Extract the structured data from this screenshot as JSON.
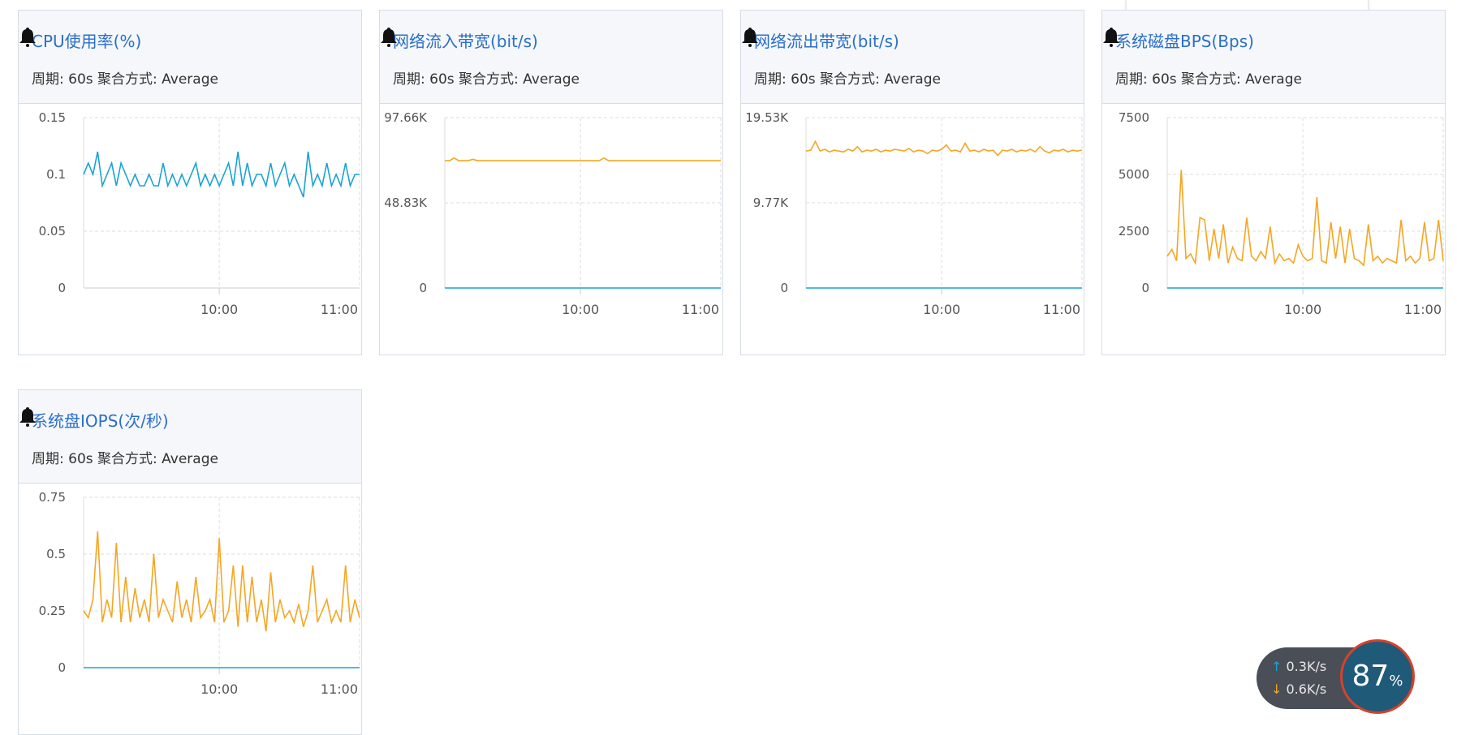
{
  "cards": [
    {
      "title": "CPU使用率(%)",
      "meta": "周期: 60s   聚合方式: Average"
    },
    {
      "title": "网络流入带宽(bit/s)",
      "meta": "周期: 60s   聚合方式: Average"
    },
    {
      "title": "网络流出带宽(bit/s)",
      "meta": "周期: 60s   聚合方式: Average"
    },
    {
      "title": "系统磁盘BPS(Bps)",
      "meta": "周期: 60s   聚合方式: Average"
    },
    {
      "title": "系统盘IOPS(次/秒)",
      "meta": "周期: 60s   聚合方式: Average"
    }
  ],
  "widget": {
    "up": "0.3K/s",
    "down": "0.6K/s",
    "percent": "87",
    "percent_sign": "%"
  },
  "colors": {
    "title": "#2a6fc9",
    "orange": "#f5a623",
    "blue": "#1aa3d3"
  },
  "chart_data": [
    {
      "type": "line",
      "ylim": [
        0,
        0.15
      ],
      "yticks": [
        "0",
        "0.05",
        "0.1",
        "0.15"
      ],
      "xticks": [
        {
          "x": 29,
          "label": "10:00"
        },
        {
          "x": 59,
          "label": "11:00"
        }
      ],
      "series": [
        {
          "color": "#1aa3d3",
          "values": [
            0.1,
            0.11,
            0.1,
            0.12,
            0.09,
            0.1,
            0.11,
            0.09,
            0.11,
            0.1,
            0.09,
            0.1,
            0.09,
            0.09,
            0.1,
            0.09,
            0.09,
            0.11,
            0.09,
            0.1,
            0.09,
            0.1,
            0.09,
            0.1,
            0.11,
            0.09,
            0.1,
            0.09,
            0.1,
            0.09,
            0.1,
            0.11,
            0.09,
            0.12,
            0.09,
            0.11,
            0.09,
            0.1,
            0.1,
            0.09,
            0.11,
            0.09,
            0.1,
            0.11,
            0.09,
            0.1,
            0.09,
            0.08,
            0.12,
            0.09,
            0.1,
            0.09,
            0.11,
            0.09,
            0.1,
            0.09,
            0.11,
            0.09,
            0.1,
            0.1
          ]
        }
      ]
    },
    {
      "type": "line",
      "ylim": [
        0,
        97.66
      ],
      "yticks": [
        "0",
        "48.83K",
        "97.66K"
      ],
      "xticks": [
        {
          "x": 29,
          "label": "10:00"
        },
        {
          "x": 59,
          "label": "11:00"
        }
      ],
      "series": [
        {
          "color": "#f5a623",
          "values": [
            73,
            73,
            74.5,
            73,
            73,
            73,
            73.8,
            73,
            73,
            73,
            73,
            73,
            73,
            73,
            73,
            73,
            73,
            73,
            73,
            73,
            73,
            73,
            73,
            73,
            73,
            73,
            73,
            73,
            73,
            73,
            73,
            73,
            73,
            73,
            74.5,
            73,
            73,
            73,
            73,
            73,
            73,
            73,
            73,
            73,
            73,
            73,
            73,
            73,
            73,
            73,
            73,
            73,
            73,
            73,
            73,
            73,
            73,
            73,
            73,
            73
          ]
        },
        {
          "color": "#1aa3d3",
          "values": [
            0,
            0,
            0,
            0,
            0,
            0,
            0,
            0,
            0,
            0,
            0,
            0,
            0,
            0,
            0,
            0,
            0,
            0,
            0,
            0,
            0,
            0,
            0,
            0,
            0,
            0,
            0,
            0,
            0,
            0,
            0,
            0,
            0,
            0,
            0,
            0,
            0,
            0,
            0,
            0,
            0,
            0,
            0,
            0,
            0,
            0,
            0,
            0,
            0,
            0,
            0,
            0,
            0,
            0,
            0,
            0,
            0,
            0,
            0,
            0
          ]
        }
      ]
    },
    {
      "type": "line",
      "ylim": [
        0,
        19.53
      ],
      "yticks": [
        "0",
        "9.77K",
        "19.53K"
      ],
      "xticks": [
        {
          "x": 29,
          "label": "10:00"
        },
        {
          "x": 59,
          "label": "11:00"
        }
      ],
      "series": [
        {
          "color": "#f5a623",
          "values": [
            15.7,
            15.8,
            16.8,
            15.7,
            15.9,
            15.6,
            15.8,
            15.7,
            15.6,
            15.9,
            15.7,
            16.2,
            15.6,
            15.8,
            15.7,
            15.9,
            15.6,
            15.8,
            15.7,
            15.9,
            15.8,
            15.7,
            16,
            15.6,
            15.8,
            15.7,
            15.4,
            15.8,
            15.7,
            15.9,
            16.4,
            15.7,
            15.8,
            15.6,
            16.6,
            15.7,
            15.8,
            15.6,
            15.9,
            15.7,
            15.8,
            15.2,
            15.8,
            15.7,
            15.9,
            15.6,
            15.8,
            15.7,
            15.9,
            15.6,
            16.2,
            15.7,
            15.5,
            15.8,
            15.7,
            15.9,
            15.6,
            15.8,
            15.7,
            15.8
          ]
        },
        {
          "color": "#1aa3d3",
          "values": [
            0,
            0,
            0,
            0,
            0,
            0,
            0,
            0,
            0,
            0,
            0,
            0,
            0,
            0,
            0,
            0,
            0,
            0,
            0,
            0,
            0,
            0,
            0,
            0,
            0,
            0,
            0,
            0,
            0,
            0,
            0,
            0,
            0,
            0,
            0,
            0,
            0,
            0,
            0,
            0,
            0,
            0,
            0,
            0,
            0,
            0,
            0,
            0,
            0,
            0,
            0,
            0,
            0,
            0,
            0,
            0,
            0,
            0,
            0,
            0
          ]
        }
      ]
    },
    {
      "type": "line",
      "ylim": [
        0,
        7500
      ],
      "yticks": [
        "0",
        "2500",
        "5000",
        "7500"
      ],
      "xticks": [
        {
          "x": 29,
          "label": "10:00"
        },
        {
          "x": 59,
          "label": "11:00"
        }
      ],
      "series": [
        {
          "color": "#f5a623",
          "values": [
            1400,
            1700,
            1200,
            5200,
            1300,
            1500,
            1100,
            3100,
            3000,
            1200,
            2600,
            1300,
            2800,
            1100,
            1800,
            1300,
            1200,
            3100,
            1400,
            1200,
            1600,
            1300,
            2700,
            1100,
            1500,
            1200,
            1300,
            1100,
            1900,
            1400,
            1200,
            1300,
            4000,
            1200,
            1100,
            2900,
            1300,
            2700,
            1100,
            2600,
            1300,
            1200,
            1000,
            2800,
            1200,
            1400,
            1100,
            1300,
            1200,
            1100,
            3000,
            1200,
            1400,
            1100,
            1300,
            2900,
            1200,
            1300,
            3000,
            1200
          ]
        },
        {
          "color": "#1aa3d3",
          "values": [
            0,
            0,
            0,
            0,
            0,
            0,
            0,
            0,
            0,
            0,
            0,
            0,
            0,
            0,
            0,
            0,
            0,
            0,
            0,
            0,
            0,
            0,
            0,
            0,
            0,
            0,
            0,
            0,
            0,
            0,
            0,
            0,
            0,
            0,
            0,
            0,
            0,
            0,
            0,
            0,
            0,
            0,
            0,
            0,
            0,
            0,
            0,
            0,
            0,
            0,
            0,
            0,
            0,
            0,
            0,
            0,
            0,
            0,
            0,
            0
          ]
        }
      ]
    },
    {
      "type": "line",
      "ylim": [
        0,
        0.75
      ],
      "yticks": [
        "0",
        "0.25",
        "0.5",
        "0.75"
      ],
      "xticks": [
        {
          "x": 29,
          "label": "10:00"
        },
        {
          "x": 59,
          "label": "11:00"
        }
      ],
      "series": [
        {
          "color": "#f5a623",
          "values": [
            0.25,
            0.22,
            0.3,
            0.6,
            0.2,
            0.3,
            0.22,
            0.55,
            0.2,
            0.4,
            0.2,
            0.35,
            0.22,
            0.3,
            0.2,
            0.5,
            0.22,
            0.3,
            0.25,
            0.2,
            0.38,
            0.22,
            0.3,
            0.2,
            0.4,
            0.22,
            0.25,
            0.3,
            0.2,
            0.57,
            0.2,
            0.25,
            0.45,
            0.18,
            0.45,
            0.2,
            0.4,
            0.2,
            0.3,
            0.16,
            0.42,
            0.2,
            0.3,
            0.22,
            0.25,
            0.2,
            0.28,
            0.18,
            0.25,
            0.45,
            0.2,
            0.25,
            0.3,
            0.2,
            0.25,
            0.2,
            0.45,
            0.2,
            0.3,
            0.22
          ]
        },
        {
          "color": "#1aa3d3",
          "values": [
            0,
            0,
            0,
            0,
            0,
            0,
            0,
            0,
            0,
            0,
            0,
            0,
            0,
            0,
            0,
            0,
            0,
            0,
            0,
            0,
            0,
            0,
            0,
            0,
            0,
            0,
            0,
            0,
            0,
            0,
            0,
            0,
            0,
            0,
            0,
            0,
            0,
            0,
            0,
            0,
            0,
            0,
            0,
            0,
            0,
            0,
            0,
            0,
            0,
            0,
            0,
            0,
            0,
            0,
            0,
            0,
            0,
            0,
            0,
            0
          ]
        }
      ]
    }
  ]
}
